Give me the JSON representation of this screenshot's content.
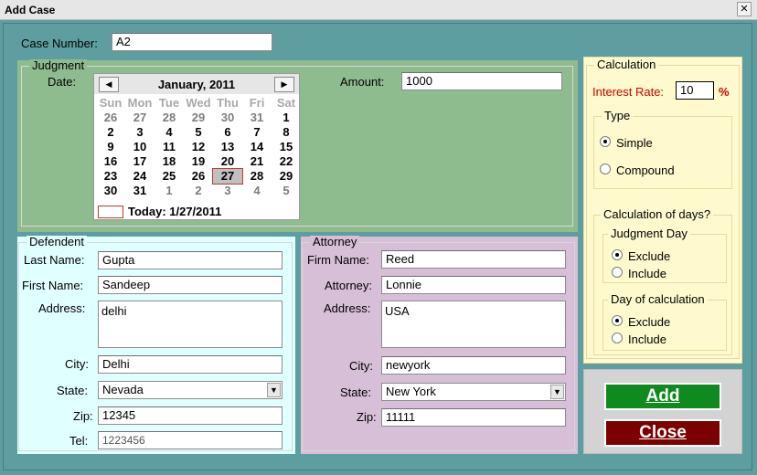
{
  "window": {
    "title": "Add Case",
    "close_glyph": "✕"
  },
  "case": {
    "label": "Case Number:",
    "value": "A2"
  },
  "judgment": {
    "legend": "Judgment",
    "date_label": "Date:",
    "amount_label": "Amount:",
    "amount_value": "1000"
  },
  "calendar": {
    "month": "January, 2011",
    "prev_icon": "◀",
    "next_icon": "▶",
    "dow": [
      "Sun",
      "Mon",
      "Tue",
      "Wed",
      "Thu",
      "Fri",
      "Sat"
    ],
    "weeks": [
      [
        "26",
        "27",
        "28",
        "29",
        "30",
        "31",
        "1"
      ],
      [
        "2",
        "3",
        "4",
        "5",
        "6",
        "7",
        "8"
      ],
      [
        "9",
        "10",
        "11",
        "12",
        "13",
        "14",
        "15"
      ],
      [
        "16",
        "17",
        "18",
        "19",
        "20",
        "21",
        "22"
      ],
      [
        "23",
        "24",
        "25",
        "26",
        "27",
        "28",
        "29"
      ],
      [
        "30",
        "31",
        "1",
        "2",
        "3",
        "4",
        "5"
      ]
    ],
    "today_label": "Today: 1/27/2011"
  },
  "defendent": {
    "legend": "Defendent",
    "last_name_label": "Last Name:",
    "last_name_value": "Gupta",
    "first_name_label": "First Name:",
    "first_name_value": "Sandeep",
    "address_label": "Address:",
    "address_value": "delhi",
    "city_label": "City:",
    "city_value": "Delhi",
    "state_label": "State:",
    "state_value": "Nevada",
    "zip_label": "Zip:",
    "zip_value": "12345",
    "tel_label": "Tel:",
    "tel_value": "1223456"
  },
  "attorney": {
    "legend": "Attorney",
    "firm_label": "Firm Name:",
    "firm_value": "Reed",
    "attorney_label": "Attorney:",
    "attorney_value": "Lonnie",
    "address_label": "Address:",
    "address_value": "USA",
    "city_label": "City:",
    "city_value": "newyork",
    "state_label": "State:",
    "state_value": "New York",
    "zip_label": "Zip:",
    "zip_value": "11111"
  },
  "calculation": {
    "legend": "Calculation",
    "interest_label": "Interest Rate:",
    "interest_value": "10",
    "percent": "%",
    "type_legend": "Type",
    "simple_label": "Simple",
    "compound_label": "Compound",
    "days_legend": "Calculation of days?",
    "judgment_day_legend": "Judgment Day",
    "jd_exclude": "Exclude",
    "jd_include": "Include",
    "calc_day_legend": "Day of calculation",
    "cd_exclude": "Exclude",
    "cd_include": "Include"
  },
  "buttons": {
    "add": "Add",
    "close": "Close"
  },
  "colors": {
    "window_bg": "#5f9ea0",
    "judgment_bg": "#8fbc8f",
    "defendent_bg": "#e0ffff",
    "attorney_bg": "#d8bfd8",
    "calc_bg": "#fffacd",
    "add_button": "#0f8a1e",
    "close_button": "#7d0000",
    "interest_label": "#cc0000"
  }
}
